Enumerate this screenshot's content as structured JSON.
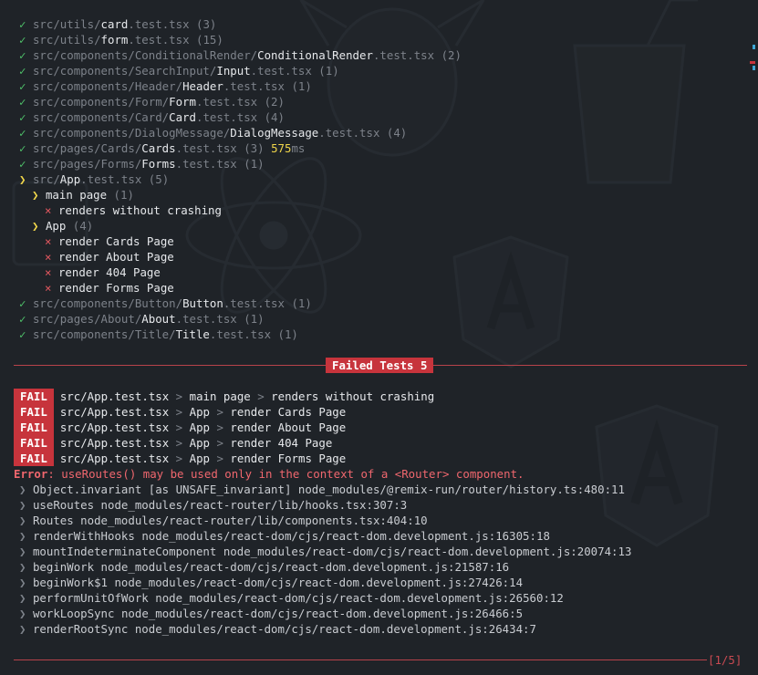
{
  "passed_suites_top": [
    {
      "check": "✓",
      "dir": "src/utils/",
      "name": "card",
      "ext": ".test.tsx",
      "count": "(3)"
    },
    {
      "check": "✓",
      "dir": "src/utils/",
      "name": "form",
      "ext": ".test.tsx",
      "count": "(15)"
    },
    {
      "check": "✓",
      "dir": "src/components/ConditionalRender/",
      "name": "ConditionalRender",
      "ext": ".test.tsx",
      "count": "(2)"
    },
    {
      "check": "✓",
      "dir": "src/components/SearchInput/",
      "name": "Input",
      "ext": ".test.tsx",
      "count": "(1)"
    },
    {
      "check": "✓",
      "dir": "src/components/Header/",
      "name": "Header",
      "ext": ".test.tsx",
      "count": "(1)"
    },
    {
      "check": "✓",
      "dir": "src/components/Form/",
      "name": "Form",
      "ext": ".test.tsx",
      "count": "(2)"
    },
    {
      "check": "✓",
      "dir": "src/components/Card/",
      "name": "Card",
      "ext": ".test.tsx",
      "count": "(4)"
    },
    {
      "check": "✓",
      "dir": "src/components/DialogMessage/",
      "name": "DialogMessage",
      "ext": ".test.tsx",
      "count": "(4)"
    },
    {
      "check": "✓",
      "dir": "src/pages/Cards/",
      "name": "Cards",
      "ext": ".test.tsx",
      "count": "(3)",
      "time": "575",
      "time_unit": "ms"
    },
    {
      "check": "✓",
      "dir": "src/pages/Forms/",
      "name": "Forms",
      "ext": ".test.tsx",
      "count": "(1)"
    }
  ],
  "failed_suite": {
    "marker": "❯",
    "dir": "src/",
    "name": "App",
    "ext": ".test.tsx",
    "count": "(5)",
    "groups": [
      {
        "marker": "❯",
        "name": "main page",
        "count": "(1)",
        "tests": [
          "renders without crashing"
        ]
      },
      {
        "marker": "❯",
        "name": "App",
        "count": "(4)",
        "tests": [
          "render Cards Page",
          "render About Page",
          "render 404 Page",
          "render Forms Page"
        ]
      }
    ],
    "fail_mark": "×"
  },
  "passed_suites_bottom": [
    {
      "check": "✓",
      "dir": "src/components/Button/",
      "name": "Button",
      "ext": ".test.tsx",
      "count": "(1)"
    },
    {
      "check": "✓",
      "dir": "src/pages/About/",
      "name": "About",
      "ext": ".test.tsx",
      "count": "(1)"
    },
    {
      "check": "✓",
      "dir": "src/components/Title/",
      "name": "Title",
      "ext": ".test.tsx",
      "count": "(1)"
    }
  ],
  "failed_header": "Failed Tests 5",
  "fail_label": "FAIL",
  "fail_rows": [
    {
      "file": "src/App.test.tsx",
      "group": "main page",
      "test": "renders without crashing"
    },
    {
      "file": "src/App.test.tsx",
      "group": "App",
      "test": "render Cards Page"
    },
    {
      "file": "src/App.test.tsx",
      "group": "App",
      "test": "render About Page"
    },
    {
      "file": "src/App.test.tsx",
      "group": "App",
      "test": "render 404 Page"
    },
    {
      "file": "src/App.test.tsx",
      "group": "App",
      "test": "render Forms Page"
    }
  ],
  "breadcrumb_sep": ">",
  "error_label": "Error",
  "error_message": ": useRoutes() may be used only in the context of a <Router> component.",
  "stack_marker": "❯",
  "stack": [
    {
      "fn": "Object.invariant [as UNSAFE_invariant]",
      "loc": "node_modules/@remix-run/router/history.ts:480:11"
    },
    {
      "fn": "useRoutes",
      "loc": "node_modules/react-router/lib/hooks.tsx:307:3"
    },
    {
      "fn": "Routes",
      "loc": "node_modules/react-router/lib/components.tsx:404:10"
    },
    {
      "fn": "renderWithHooks",
      "loc": "node_modules/react-dom/cjs/react-dom.development.js:16305:18"
    },
    {
      "fn": "mountIndeterminateComponent",
      "loc": "node_modules/react-dom/cjs/react-dom.development.js:20074:13"
    },
    {
      "fn": "beginWork",
      "loc": "node_modules/react-dom/cjs/react-dom.development.js:21587:16"
    },
    {
      "fn": "beginWork$1",
      "loc": "node_modules/react-dom/cjs/react-dom.development.js:27426:14"
    },
    {
      "fn": "performUnitOfWork",
      "loc": "node_modules/react-dom/cjs/react-dom.development.js:26560:12"
    },
    {
      "fn": "workLoopSync",
      "loc": "node_modules/react-dom/cjs/react-dom.development.js:26466:5"
    },
    {
      "fn": "renderRootSync",
      "loc": "node_modules/react-dom/cjs/react-dom.development.js:26434:7"
    }
  ],
  "page_indicator": "[1/5]",
  "background_watermarks": [
    "ts-logo",
    "react-logo",
    "angular-logo",
    "gulp-cup",
    "grunt-boar"
  ],
  "colors": {
    "background": "#1f2328",
    "pass": "#4fc26a",
    "fail": "#c7343c",
    "warn": "#f0d64a",
    "muted": "#7d828a",
    "text": "#e6e8eb"
  }
}
